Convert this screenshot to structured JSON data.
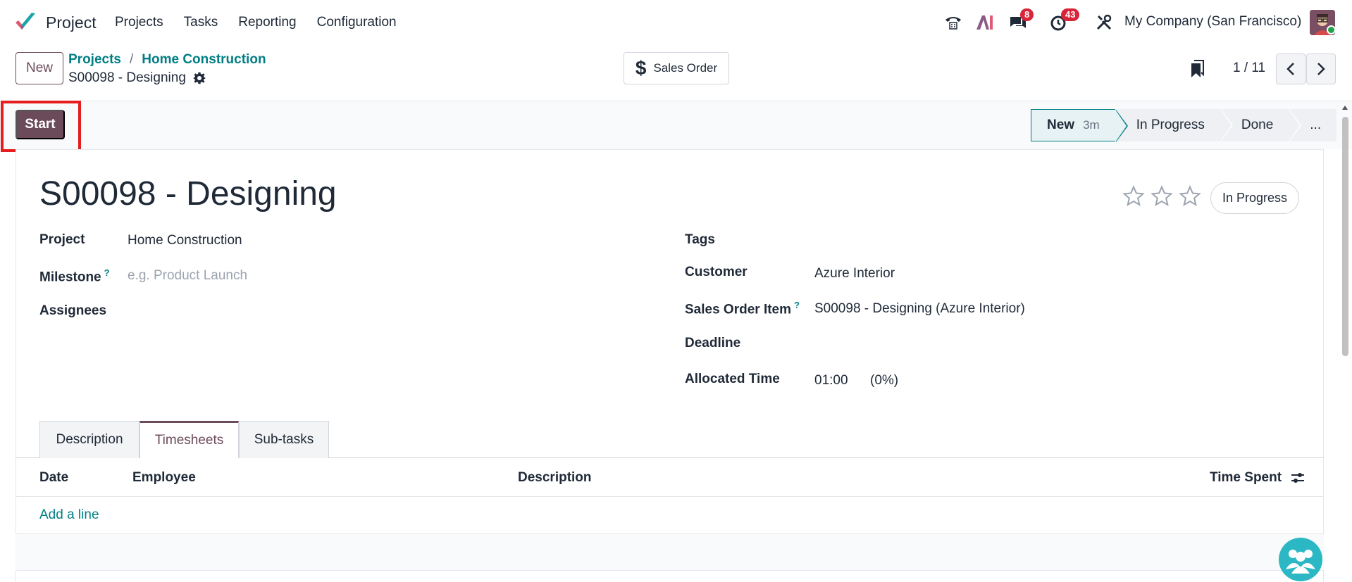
{
  "navbar": {
    "app_name": "Project",
    "menu": [
      "Projects",
      "Tasks",
      "Reporting",
      "Configuration"
    ],
    "messages_badge": "8",
    "activities_badge": "43",
    "company": "My Company (San Francisco)"
  },
  "control": {
    "new_label": "New",
    "breadcrumb": [
      "Projects",
      "Home Construction"
    ],
    "breadcrumb_sep": "/",
    "record_title": "S00098 - Designing",
    "sales_order_label": "Sales Order",
    "pager": "1 / 11"
  },
  "statusbar": {
    "start_label": "Start",
    "stages": [
      {
        "label": "New",
        "duration": "3m"
      },
      {
        "label": "In Progress"
      },
      {
        "label": "Done"
      },
      {
        "label": "..."
      }
    ]
  },
  "form": {
    "title": "S00098 - Designing",
    "status_pill": "In Progress",
    "project_label": "Project",
    "project_value": "Home Construction",
    "milestone_label": "Milestone",
    "milestone_placeholder": "e.g. Product Launch",
    "assignees_label": "Assignees",
    "tags_label": "Tags",
    "customer_label": "Customer",
    "customer_value": "Azure Interior",
    "soi_label": "Sales Order Item",
    "soi_value": "S00098 - Designing (Azure Interior)",
    "deadline_label": "Deadline",
    "allocated_label": "Allocated Time",
    "allocated_value": "01:00",
    "allocated_pct": "(0%)",
    "help_mark": "?"
  },
  "tabs": [
    "Description",
    "Timesheets",
    "Sub-tasks"
  ],
  "timesheets": {
    "columns": [
      "Date",
      "Employee",
      "Description",
      "Time Spent"
    ],
    "add_line": "Add a line"
  },
  "colors": {
    "brand": "#6b4a5a",
    "link": "#017e84",
    "badge": "#d9253a"
  }
}
